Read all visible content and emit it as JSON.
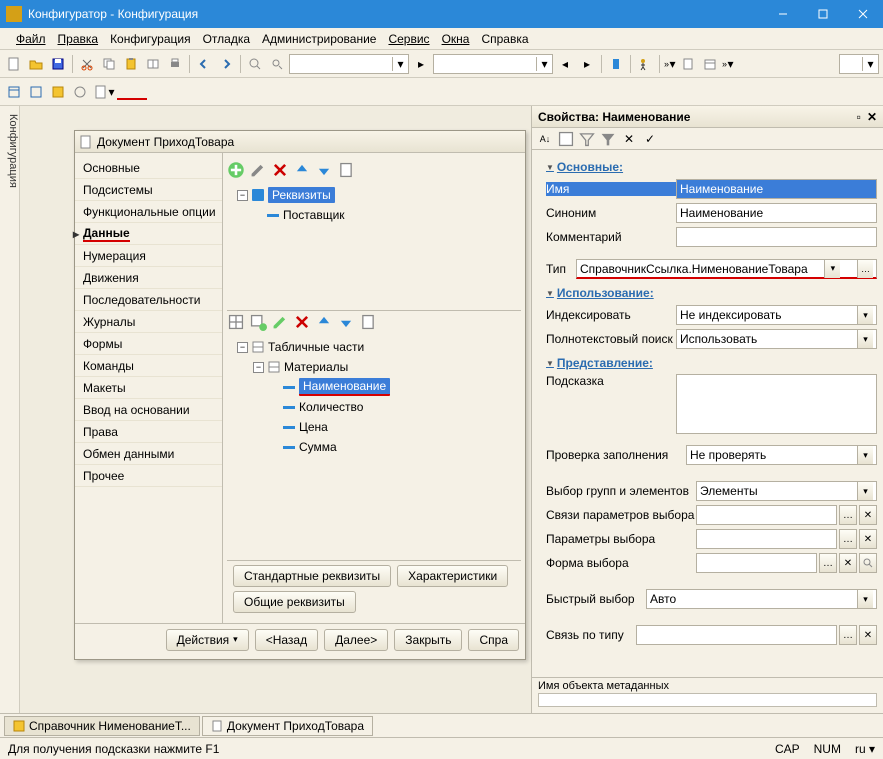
{
  "titlebar": {
    "title": "Конфигуратор - Конфигурация"
  },
  "menu": {
    "file": "Файл",
    "edit": "Правка",
    "config": "Конфигурация",
    "debug": "Отладка",
    "admin": "Администрирование",
    "service": "Сервис",
    "windows": "Окна",
    "help": "Справка"
  },
  "vtab": "Конфигурация",
  "doc": {
    "title": "Документ ПриходТовара",
    "nav": {
      "n0": "Основные",
      "n1": "Подсистемы",
      "n2": "Функциональные опции",
      "n3": "Данные",
      "n4": "Нумерация",
      "n5": "Движения",
      "n6": "Последовательности",
      "n7": "Журналы",
      "n8": "Формы",
      "n9": "Команды",
      "n10": "Макеты",
      "n11": "Ввод на основании",
      "n12": "Права",
      "n13": "Обмен данными",
      "n14": "Прочее"
    },
    "tree1": {
      "root": "Реквизиты",
      "i0": "Поставщик"
    },
    "tree2": {
      "root": "Табличные части",
      "g0": "Материалы",
      "a0": "Наименование",
      "a1": "Количество",
      "a2": "Цена",
      "a3": "Сумма"
    },
    "btns": {
      "std": "Стандартные реквизиты",
      "char": "Характеристики",
      "common": "Общие реквизиты"
    },
    "footer": {
      "actions": "Действия",
      "back": "<Назад",
      "next": "Далее>",
      "close": "Закрыть",
      "help": "Спра"
    }
  },
  "props": {
    "title": "Свойства: Наименование",
    "groups": {
      "g0": "Основные:",
      "g1": "Использование:",
      "g2": "Представление:"
    },
    "labels": {
      "name": "Имя",
      "syn": "Синоним",
      "comment": "Комментарий",
      "type": "Тип",
      "index": "Индексировать",
      "fulltext": "Полнотекстовый поиск",
      "hint": "Подсказка",
      "fillcheck": "Проверка заполнения",
      "groupsel": "Выбор групп и элементов",
      "linkparams": "Связи параметров выбора",
      "params": "Параметры выбора",
      "selform": "Форма выбора",
      "quicksel": "Быстрый выбор",
      "linktype": "Связь по типу",
      "metaname": "Имя объекта метаданных"
    },
    "values": {
      "name": "Наименование",
      "syn": "Наименование",
      "type": "СправочникСсылка.НименованиеТовара",
      "index": "Не индексировать",
      "fulltext": "Использовать",
      "fillcheck": "Не проверять",
      "groupsel": "Элементы",
      "quicksel": "Авто"
    }
  },
  "bottomtabs": {
    "t0": "Справочник НименованиеТ...",
    "t1": "Документ ПриходТовара"
  },
  "status": {
    "hint": "Для получения подсказки нажмите F1",
    "cap": "CAP",
    "num": "NUM",
    "lang": "ru"
  }
}
